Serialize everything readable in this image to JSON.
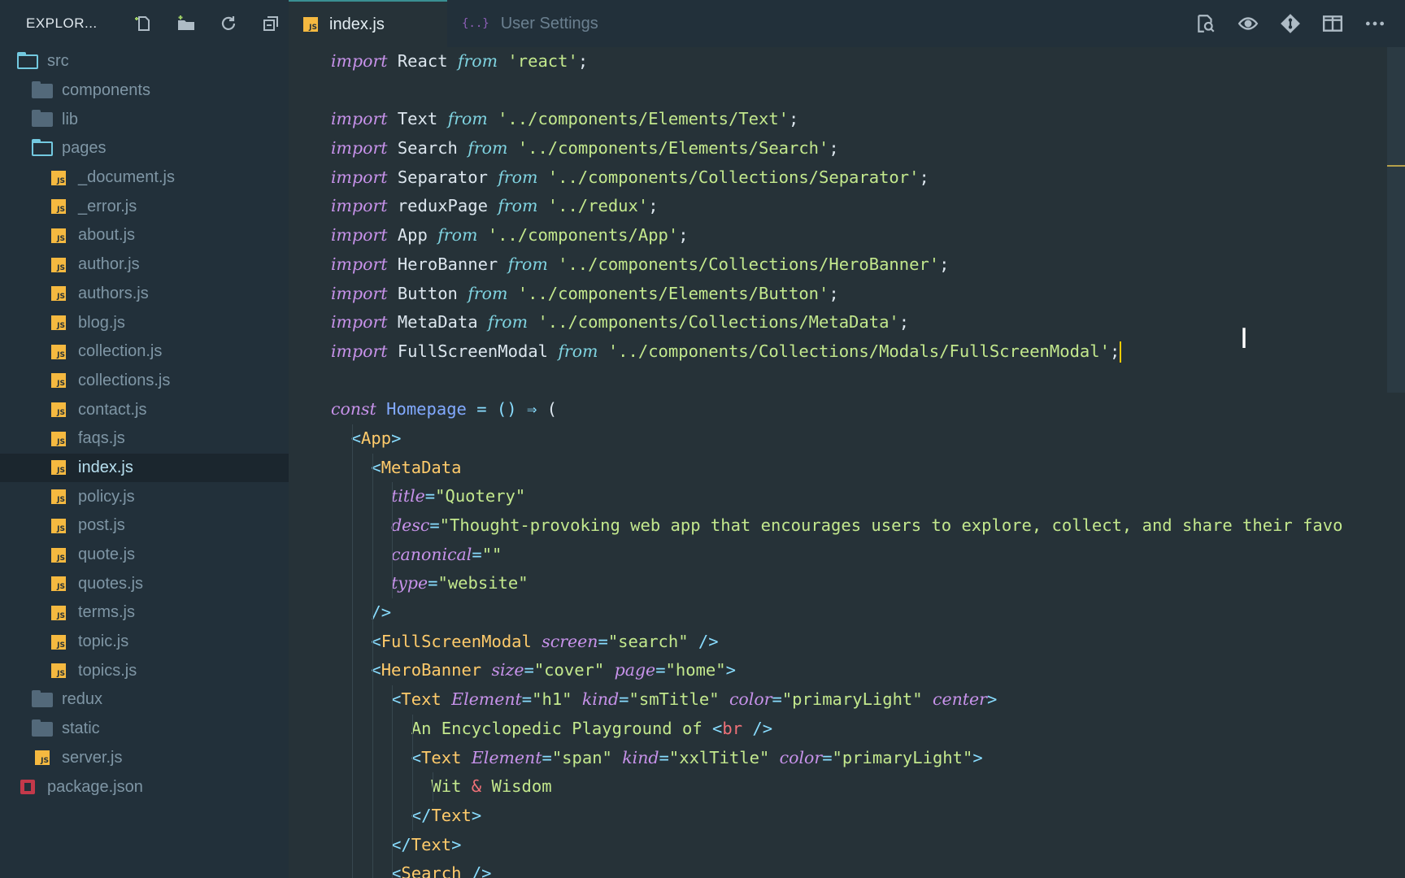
{
  "sidebar": {
    "title": "EXPLOR...",
    "actions": [
      {
        "name": "new-file-icon"
      },
      {
        "name": "new-folder-icon"
      },
      {
        "name": "refresh-icon"
      },
      {
        "name": "collapse-all-icon"
      }
    ],
    "tree": [
      {
        "label": "src",
        "type": "folder-open",
        "depth": 0
      },
      {
        "label": "components",
        "type": "folder",
        "depth": 1
      },
      {
        "label": "lib",
        "type": "folder",
        "depth": 1
      },
      {
        "label": "pages",
        "type": "folder-open",
        "depth": 1
      },
      {
        "label": "_document.js",
        "type": "js",
        "depth": 2
      },
      {
        "label": "_error.js",
        "type": "js",
        "depth": 2
      },
      {
        "label": "about.js",
        "type": "js",
        "depth": 2
      },
      {
        "label": "author.js",
        "type": "js",
        "depth": 2
      },
      {
        "label": "authors.js",
        "type": "js",
        "depth": 2
      },
      {
        "label": "blog.js",
        "type": "js",
        "depth": 2
      },
      {
        "label": "collection.js",
        "type": "js",
        "depth": 2
      },
      {
        "label": "collections.js",
        "type": "js",
        "depth": 2
      },
      {
        "label": "contact.js",
        "type": "js",
        "depth": 2
      },
      {
        "label": "faqs.js",
        "type": "js",
        "depth": 2
      },
      {
        "label": "index.js",
        "type": "js",
        "depth": 2,
        "active": true
      },
      {
        "label": "policy.js",
        "type": "js",
        "depth": 2
      },
      {
        "label": "post.js",
        "type": "js",
        "depth": 2
      },
      {
        "label": "quote.js",
        "type": "js",
        "depth": 2
      },
      {
        "label": "quotes.js",
        "type": "js",
        "depth": 2
      },
      {
        "label": "terms.js",
        "type": "js",
        "depth": 2
      },
      {
        "label": "topic.js",
        "type": "js",
        "depth": 2
      },
      {
        "label": "topics.js",
        "type": "js",
        "depth": 2
      },
      {
        "label": "redux",
        "type": "folder",
        "depth": 1
      },
      {
        "label": "static",
        "type": "folder",
        "depth": 1
      },
      {
        "label": "server.js",
        "type": "js",
        "depth": 1
      },
      {
        "label": "package.json",
        "type": "pkg",
        "depth": 0
      }
    ]
  },
  "tabs": [
    {
      "label": "index.js",
      "active": true,
      "icon": "js-file-icon"
    },
    {
      "label": "User Settings",
      "active": false,
      "icon": "settings-json-icon"
    }
  ],
  "editor_actions": [
    {
      "name": "search-preview-icon"
    },
    {
      "name": "eye-icon"
    },
    {
      "name": "git-icon"
    },
    {
      "name": "split-editor-icon"
    },
    {
      "name": "more-icon"
    }
  ],
  "code_lines": [
    [
      [
        "kw",
        "import"
      ],
      [
        "t",
        " React "
      ],
      [
        "from",
        "from"
      ],
      [
        "t",
        " "
      ],
      [
        "str",
        "'react'"
      ],
      [
        "t",
        ";"
      ]
    ],
    [],
    [
      [
        "kw",
        "import"
      ],
      [
        "t",
        " Text "
      ],
      [
        "from",
        "from"
      ],
      [
        "t",
        " "
      ],
      [
        "str",
        "'../components/Elements/Text'"
      ],
      [
        "t",
        ";"
      ]
    ],
    [
      [
        "kw",
        "import"
      ],
      [
        "t",
        " Search "
      ],
      [
        "from",
        "from"
      ],
      [
        "t",
        " "
      ],
      [
        "str",
        "'../components/Elements/Search'"
      ],
      [
        "t",
        ";"
      ]
    ],
    [
      [
        "kw",
        "import"
      ],
      [
        "t",
        " Separator "
      ],
      [
        "from",
        "from"
      ],
      [
        "t",
        " "
      ],
      [
        "str",
        "'../components/Collections/Separator'"
      ],
      [
        "t",
        ";"
      ]
    ],
    [
      [
        "kw",
        "import"
      ],
      [
        "t",
        " reduxPage "
      ],
      [
        "from",
        "from"
      ],
      [
        "t",
        " "
      ],
      [
        "str",
        "'../redux'"
      ],
      [
        "t",
        ";"
      ]
    ],
    [
      [
        "kw",
        "import"
      ],
      [
        "t",
        " App "
      ],
      [
        "from",
        "from"
      ],
      [
        "t",
        " "
      ],
      [
        "str",
        "'../components/App'"
      ],
      [
        "t",
        ";"
      ]
    ],
    [
      [
        "kw",
        "import"
      ],
      [
        "t",
        " HeroBanner "
      ],
      [
        "from",
        "from"
      ],
      [
        "t",
        " "
      ],
      [
        "str",
        "'../components/Collections/HeroBanner'"
      ],
      [
        "t",
        ";"
      ]
    ],
    [
      [
        "kw",
        "import"
      ],
      [
        "t",
        " Button "
      ],
      [
        "from",
        "from"
      ],
      [
        "t",
        " "
      ],
      [
        "str",
        "'../components/Elements/Button'"
      ],
      [
        "t",
        ";"
      ]
    ],
    [
      [
        "kw",
        "import"
      ],
      [
        "t",
        " MetaData "
      ],
      [
        "from",
        "from"
      ],
      [
        "t",
        " "
      ],
      [
        "str",
        "'../components/Collections/MetaData'"
      ],
      [
        "t",
        ";"
      ]
    ],
    [
      [
        "kw",
        "import"
      ],
      [
        "t",
        " FullScreenModal "
      ],
      [
        "from",
        "from"
      ],
      [
        "t",
        " "
      ],
      [
        "str",
        "'../components/Collections/Modals/FullScreenModal'"
      ],
      [
        "t",
        ";"
      ],
      [
        "cursor",
        ""
      ]
    ],
    [],
    [
      [
        "kw",
        "const"
      ],
      [
        "t",
        " "
      ],
      [
        "fn",
        "Homepage"
      ],
      [
        "t",
        " "
      ],
      [
        "punc",
        "="
      ],
      [
        "t",
        " "
      ],
      [
        "punc",
        "()"
      ],
      [
        "t",
        " "
      ],
      [
        "punc",
        "⇒"
      ],
      [
        "t",
        " ("
      ]
    ],
    [
      [
        "t",
        "  "
      ],
      [
        "punc",
        "<"
      ],
      [
        "tag",
        "App"
      ],
      [
        "punc",
        ">"
      ]
    ],
    [
      [
        "t",
        "    "
      ],
      [
        "punc",
        "<"
      ],
      [
        "tag",
        "MetaData"
      ]
    ],
    [
      [
        "t",
        "      "
      ],
      [
        "attr",
        "title"
      ],
      [
        "punc",
        "="
      ],
      [
        "str",
        "\"Quotery\""
      ]
    ],
    [
      [
        "t",
        "      "
      ],
      [
        "attr",
        "desc"
      ],
      [
        "punc",
        "="
      ],
      [
        "str",
        "\"Thought-provoking web app that encourages users to explore, collect, and share their favo"
      ]
    ],
    [
      [
        "t",
        "      "
      ],
      [
        "attr",
        "canonical"
      ],
      [
        "punc",
        "="
      ],
      [
        "str",
        "\"\""
      ]
    ],
    [
      [
        "t",
        "      "
      ],
      [
        "attr",
        "type"
      ],
      [
        "punc",
        "="
      ],
      [
        "str",
        "\"website\""
      ]
    ],
    [
      [
        "t",
        "    "
      ],
      [
        "punc",
        "/>"
      ]
    ],
    [
      [
        "t",
        "    "
      ],
      [
        "punc",
        "<"
      ],
      [
        "tag",
        "FullScreenModal"
      ],
      [
        "t",
        " "
      ],
      [
        "attr",
        "screen"
      ],
      [
        "punc",
        "="
      ],
      [
        "str",
        "\"search\""
      ],
      [
        "t",
        " "
      ],
      [
        "punc",
        "/>"
      ]
    ],
    [
      [
        "t",
        "    "
      ],
      [
        "punc",
        "<"
      ],
      [
        "tag",
        "HeroBanner"
      ],
      [
        "t",
        " "
      ],
      [
        "attr",
        "size"
      ],
      [
        "punc",
        "="
      ],
      [
        "str",
        "\"cover\""
      ],
      [
        "t",
        " "
      ],
      [
        "attr",
        "page"
      ],
      [
        "punc",
        "="
      ],
      [
        "str",
        "\"home\""
      ],
      [
        "punc",
        ">"
      ]
    ],
    [
      [
        "t",
        "      "
      ],
      [
        "punc",
        "<"
      ],
      [
        "tag",
        "Text"
      ],
      [
        "t",
        " "
      ],
      [
        "attr",
        "Element"
      ],
      [
        "punc",
        "="
      ],
      [
        "str",
        "\"h1\""
      ],
      [
        "t",
        " "
      ],
      [
        "attr",
        "kind"
      ],
      [
        "punc",
        "="
      ],
      [
        "str",
        "\"smTitle\""
      ],
      [
        "t",
        " "
      ],
      [
        "attr",
        "color"
      ],
      [
        "punc",
        "="
      ],
      [
        "str",
        "\"primaryLight\""
      ],
      [
        "t",
        " "
      ],
      [
        "attr",
        "center"
      ],
      [
        "punc",
        ">"
      ]
    ],
    [
      [
        "t",
        "        "
      ],
      [
        "str",
        "An Encyclopedic Playground of "
      ],
      [
        "punc",
        "<"
      ],
      [
        "br",
        "br"
      ],
      [
        "t",
        " "
      ],
      [
        "punc",
        "/>"
      ]
    ],
    [
      [
        "t",
        "        "
      ],
      [
        "punc",
        "<"
      ],
      [
        "tag",
        "Text"
      ],
      [
        "t",
        " "
      ],
      [
        "attr",
        "Element"
      ],
      [
        "punc",
        "="
      ],
      [
        "str",
        "\"span\""
      ],
      [
        "t",
        " "
      ],
      [
        "attr",
        "kind"
      ],
      [
        "punc",
        "="
      ],
      [
        "str",
        "\"xxlTitle\""
      ],
      [
        "t",
        " "
      ],
      [
        "attr",
        "color"
      ],
      [
        "punc",
        "="
      ],
      [
        "str",
        "\"primaryLight\""
      ],
      [
        "punc",
        ">"
      ]
    ],
    [
      [
        "t",
        "          "
      ],
      [
        "str",
        "Wit "
      ],
      [
        "amp",
        "&"
      ],
      [
        "str",
        " Wisdom"
      ]
    ],
    [
      [
        "t",
        "        "
      ],
      [
        "punc",
        "</"
      ],
      [
        "tag",
        "Text"
      ],
      [
        "punc",
        ">"
      ]
    ],
    [
      [
        "t",
        "      "
      ],
      [
        "punc",
        "</"
      ],
      [
        "tag",
        "Text"
      ],
      [
        "punc",
        ">"
      ]
    ],
    [
      [
        "t",
        "      "
      ],
      [
        "punc",
        "<"
      ],
      [
        "tag",
        "Search"
      ],
      [
        "t",
        " "
      ],
      [
        "punc",
        "/>"
      ]
    ]
  ]
}
